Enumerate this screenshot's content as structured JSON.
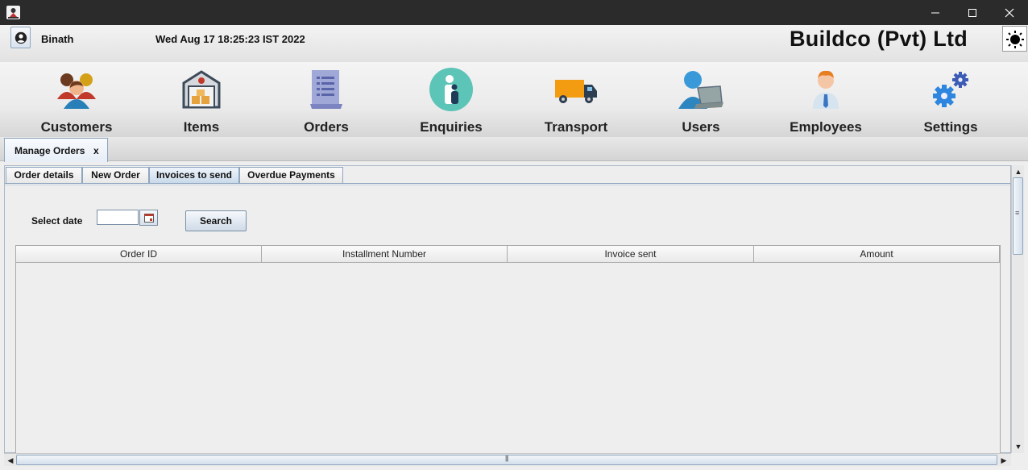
{
  "window": {
    "minimize": "—",
    "maximize": "☐",
    "close": "✕"
  },
  "header": {
    "user_name": "Binath",
    "datetime": "Wed Aug 17 18:25:23 IST 2022",
    "company": "Buildco (Pvt) Ltd"
  },
  "nav": {
    "items": [
      {
        "label": "Customers",
        "icon": "customers-icon"
      },
      {
        "label": "Items",
        "icon": "warehouse-icon"
      },
      {
        "label": "Orders",
        "icon": "document-icon"
      },
      {
        "label": "Enquiries",
        "icon": "info-person-icon"
      },
      {
        "label": "Transport",
        "icon": "truck-icon"
      },
      {
        "label": "Users",
        "icon": "user-laptop-icon"
      },
      {
        "label": "Employees",
        "icon": "employee-icon"
      },
      {
        "label": "Settings",
        "icon": "gears-icon"
      }
    ]
  },
  "module_tab": {
    "title": "Manage Orders",
    "close": "x"
  },
  "subtabs": [
    {
      "label": "Order details",
      "active": false
    },
    {
      "label": "New Order",
      "active": false
    },
    {
      "label": "Invoices to send",
      "active": true
    },
    {
      "label": "Overdue Payments",
      "active": false
    }
  ],
  "filter": {
    "select_date_label": "Select date",
    "date_value": "",
    "search_label": "Search"
  },
  "table": {
    "columns": [
      "Order ID",
      "Installment Number",
      "Invoice sent",
      "Amount"
    ],
    "rows": []
  },
  "colors": {
    "titlebar": "#2b2b2b",
    "accent_border": "#8fa6bf",
    "active_tab": "#c9daea"
  }
}
